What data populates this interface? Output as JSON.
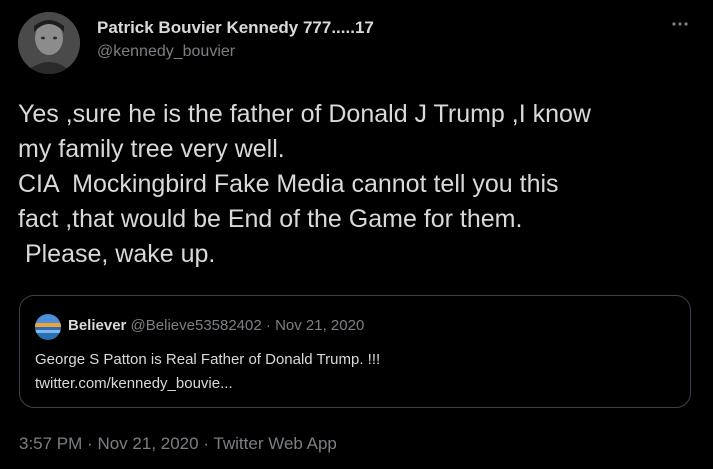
{
  "tweet": {
    "author": {
      "name": "Patrick Bouvier Kennedy 777.....17",
      "handle": "@kennedy_bouvier",
      "avatar_icon": "profile-photo-icon"
    },
    "more_icon": "more-options-icon",
    "text_lines": [
      "Yes ,sure he is the father of Donald J Trump ,I know",
      "my family tree very well.",
      "CIA  Mockingbird Fake Media cannot tell you this",
      "fact ,that would be End of the Game for them.",
      " Please, wake up."
    ],
    "quote": {
      "name": "Believer",
      "handle": "@Believe53582402",
      "separator": "·",
      "date": "Nov 21, 2020",
      "avatar_icon": "sunset-avatar-icon",
      "text_lines": [
        "George S Patton is Real Father of Donald Trump. !!!",
        "twitter.com/kennedy_bouvie..."
      ]
    },
    "footer": {
      "time": "3:57 PM",
      "separator": "·",
      "date": "Nov 21, 2020",
      "source": "Twitter Web App"
    }
  },
  "colors": {
    "background": "#000000",
    "text": "#d9d9d9",
    "secondary_text": "#7b7f83",
    "border": "#38444d"
  }
}
